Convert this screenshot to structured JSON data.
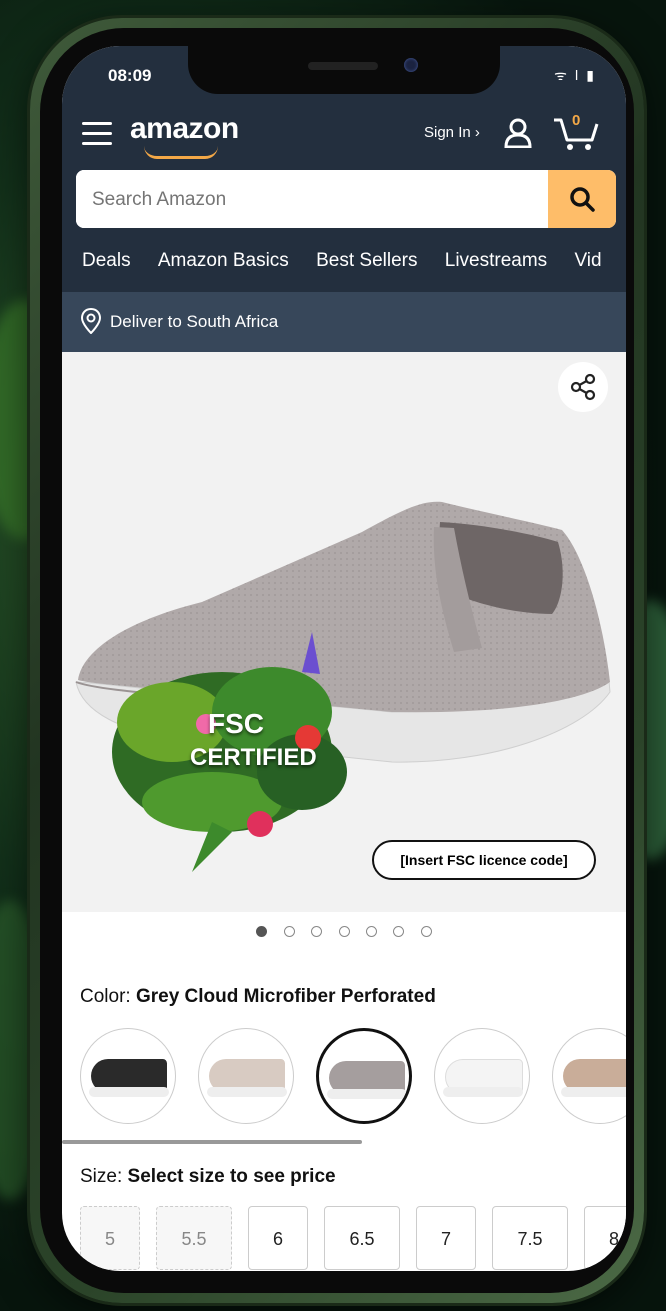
{
  "status_bar": {
    "time": "08:09",
    "icons": "ᯤ ǀ ▮"
  },
  "header": {
    "logo": "amazon",
    "sign_in": "Sign In ›",
    "cart_count": "0"
  },
  "search": {
    "placeholder": "Search Amazon"
  },
  "nav": {
    "items": [
      "Deals",
      "Amazon Basics",
      "Best Sellers",
      "Livestreams",
      "Vid"
    ]
  },
  "deliver": {
    "text": "Deliver to South Africa"
  },
  "product": {
    "fsc_line1": "FSC",
    "fsc_line2": "CERTIFIED",
    "licence_label": "[Insert FSC licence code]",
    "image_count": 7,
    "active_image": 1
  },
  "color": {
    "label": "Color: ",
    "selected": "Grey Cloud Microfiber Perforated",
    "swatches": [
      "black",
      "beige",
      "grey",
      "white",
      "tan"
    ],
    "selected_index": 2
  },
  "size": {
    "label": "Size: ",
    "hint": "Select size to see price",
    "options": [
      "5",
      "5.5",
      "6",
      "6.5",
      "7",
      "7.5",
      "8"
    ],
    "unavailable": [
      "5",
      "5.5"
    ]
  },
  "colors": {
    "header_bg": "#232f3e",
    "deliver_bg": "#37475a",
    "search_button": "#febd69",
    "accent": "#f3a847"
  }
}
